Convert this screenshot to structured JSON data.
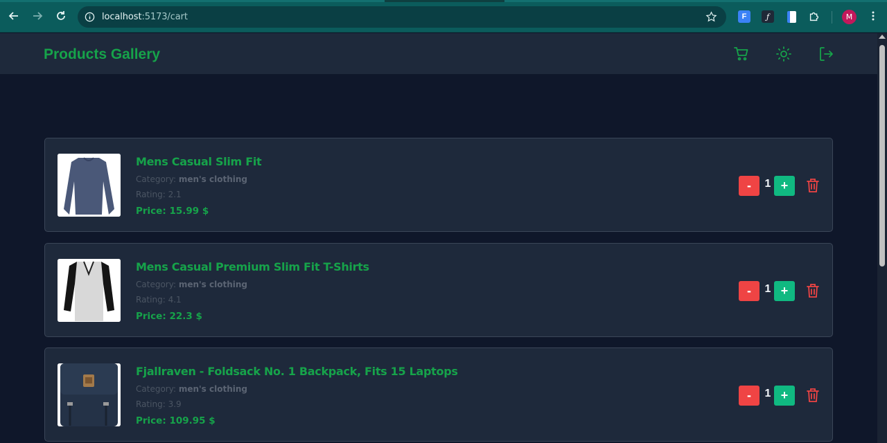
{
  "browser": {
    "url_host": "localhost",
    "url_path": ":5173/cart",
    "profile_initial": "M"
  },
  "app": {
    "brand": "Products Gallery",
    "accent": "#16a34a",
    "header_icons": [
      "cart-icon",
      "sun-icon",
      "logout-icon"
    ]
  },
  "cart": {
    "category_label": "Category:",
    "rating_label": "Rating:",
    "price_label": "Price:",
    "price_suffix": "$",
    "minus_label": "-",
    "plus_label": "+",
    "items": [
      {
        "title": "Mens Casual Slim Fit",
        "category": "men's clothing",
        "rating": "2.1",
        "price": "15.99",
        "quantity": "1"
      },
      {
        "title": "Mens Casual Premium Slim Fit T-Shirts",
        "category": "men's clothing",
        "rating": "4.1",
        "price": "22.3",
        "quantity": "1"
      },
      {
        "title": "Fjallraven - Foldsack No. 1 Backpack, Fits 15 Laptops",
        "category": "men's clothing",
        "rating": "3.9",
        "price": "109.95",
        "quantity": "1"
      }
    ]
  }
}
